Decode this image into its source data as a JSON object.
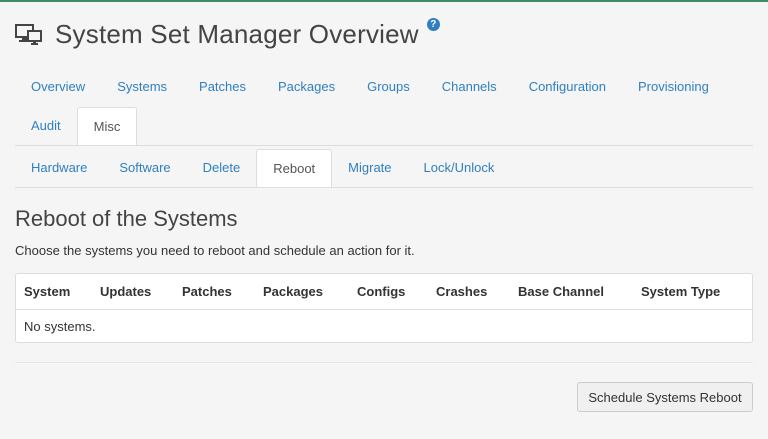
{
  "header": {
    "title": "System Set Manager Overview",
    "title_icon": "monitor-icon",
    "help_icon": "help-icon",
    "help_text": "?"
  },
  "main_tabs": [
    {
      "label": "Overview"
    },
    {
      "label": "Systems"
    },
    {
      "label": "Patches"
    },
    {
      "label": "Packages"
    },
    {
      "label": "Groups"
    },
    {
      "label": "Channels"
    },
    {
      "label": "Configuration"
    },
    {
      "label": "Provisioning"
    },
    {
      "label": "Audit"
    },
    {
      "label": "Misc",
      "active": true
    }
  ],
  "sub_tabs": [
    {
      "label": "Hardware"
    },
    {
      "label": "Software"
    },
    {
      "label": "Delete"
    },
    {
      "label": "Reboot",
      "active": true
    },
    {
      "label": "Migrate"
    },
    {
      "label": "Lock/Unlock"
    }
  ],
  "section": {
    "title": "Reboot of the Systems",
    "description": "Choose the systems you need to reboot and schedule an action for it."
  },
  "table": {
    "columns": [
      "System",
      "Updates",
      "Patches",
      "Packages",
      "Configs",
      "Crashes",
      "Base Channel",
      "System Type"
    ],
    "empty_message": "No systems."
  },
  "actions": {
    "schedule_button": "Schedule Systems Reboot"
  },
  "colors": {
    "accent": "#2f7fc1",
    "top_line": "#3c8d65",
    "background": "#f5f5f5"
  }
}
